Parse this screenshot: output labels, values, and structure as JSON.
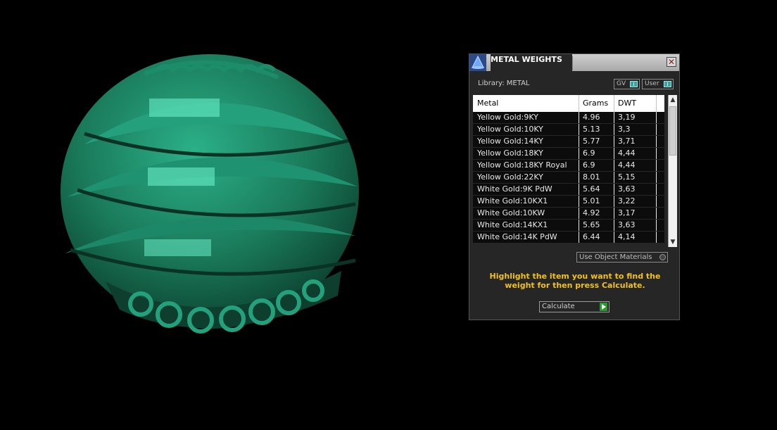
{
  "viewport": {
    "object_color": "#1e8a66"
  },
  "panel": {
    "title": "METAL WEIGHTS",
    "close_icon": "close-icon",
    "library_label": "Library: METAL",
    "gv_toggle": "GV",
    "user_toggle": "User",
    "table": {
      "headers": [
        "Metal",
        "Grams",
        "DWT"
      ],
      "rows": [
        [
          "Yellow Gold:9KY",
          "4.96",
          "3,19"
        ],
        [
          "Yellow Gold:10KY",
          "5.13",
          "3,3"
        ],
        [
          "Yellow Gold:14KY",
          "5.77",
          "3,71"
        ],
        [
          "Yellow Gold:18KY",
          "6.9",
          "4,44"
        ],
        [
          "Yellow Gold:18KY Royal",
          "6.9",
          "4,44"
        ],
        [
          "Yellow Gold:22KY",
          "8.01",
          "5,15"
        ],
        [
          "White Gold:9K PdW",
          "5.64",
          "3,63"
        ],
        [
          "White Gold:10KX1",
          "5.01",
          "3,22"
        ],
        [
          "White Gold:10KW",
          "4.92",
          "3,17"
        ],
        [
          "White Gold:14KX1",
          "5.65",
          "3,63"
        ],
        [
          "White Gold:14K PdW",
          "6.44",
          "4,14"
        ]
      ]
    },
    "use_object_materials": "Use Object Materials",
    "instructions": "Highlight the item you want to find the weight for then press Calculate.",
    "calculate_label": "Calculate"
  }
}
